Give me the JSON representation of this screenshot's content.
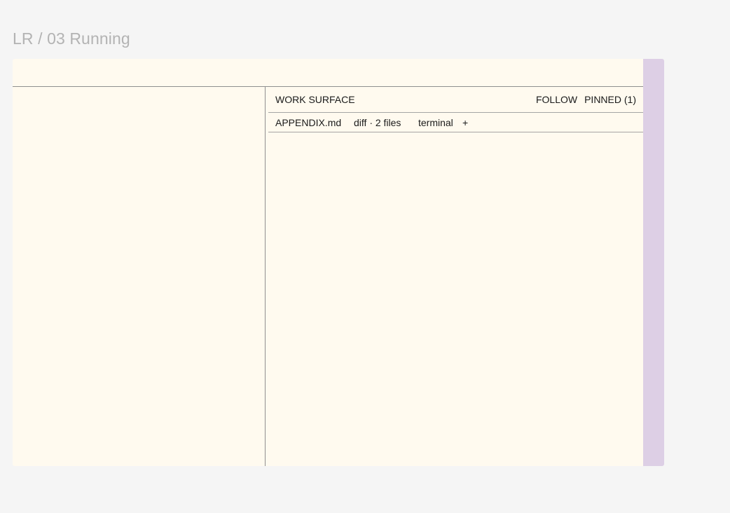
{
  "frame": {
    "title": "LR / 03 Running"
  },
  "work_surface": {
    "title": "WORK SURFACE",
    "actions": {
      "follow": "FOLLOW",
      "pinned": "PINNED (1)"
    },
    "tabs": [
      {
        "label": "APPENDIX.md"
      },
      {
        "label": "diff · 2 files"
      },
      {
        "label": "terminal"
      }
    ],
    "add_tab_label": "+"
  }
}
